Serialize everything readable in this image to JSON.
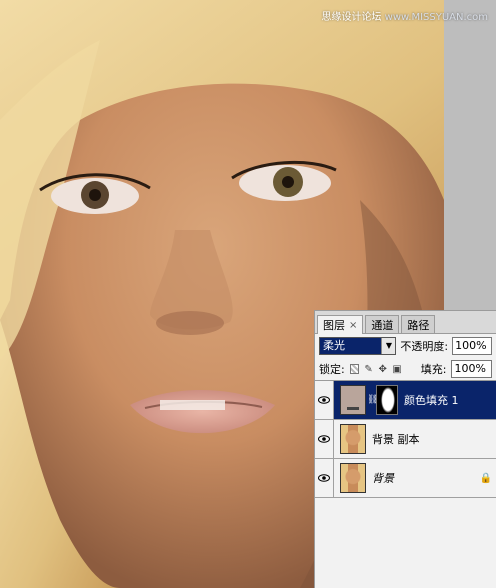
{
  "watermark": {
    "chinese": "思缘设计论坛",
    "site": "www.MISSYUAN.com"
  },
  "layers_panel": {
    "tabs": [
      {
        "label": "图层",
        "close": "×"
      },
      {
        "label": "通道"
      },
      {
        "label": "路径"
      }
    ],
    "blend_mode": "柔光",
    "opacity_label": "不透明度:",
    "opacity_value": "100%",
    "lock_label": "锁定:",
    "fill_label": "填充:",
    "fill_value": "100%",
    "lock_icons": [
      "transparent-pixels-icon",
      "brush-icon",
      "move-icon",
      "padlock-icon"
    ],
    "layers": [
      {
        "name": "颜色填充 1",
        "selected": true,
        "type": "fill",
        "thumb_color": "#b9a59b"
      },
      {
        "name": "背景 副本",
        "selected": false,
        "type": "photo"
      },
      {
        "name": "背景",
        "selected": false,
        "type": "photo",
        "locked": true
      }
    ]
  },
  "colors": {
    "selection": "#0a246a",
    "panel_bg": "#f2f2f2"
  }
}
